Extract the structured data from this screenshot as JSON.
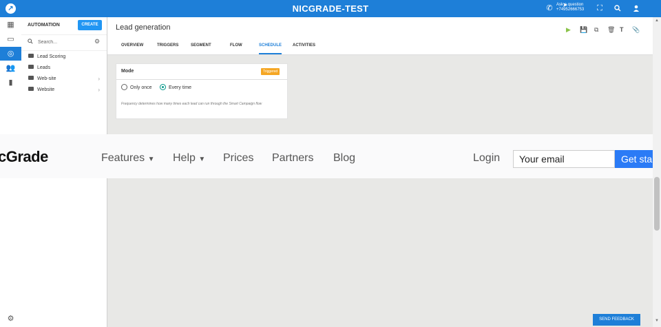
{
  "topbar": {
    "title": "NICGRADE-TEST",
    "logo_icon": "nicgrade-logo-icon",
    "ask_question": "Ask a question",
    "phone_number": "+74952666753",
    "icons": [
      "phone-icon",
      "fullscreen-icon",
      "search-icon",
      "user-icon"
    ]
  },
  "leftnav": {
    "icons": [
      "dashboard-icon",
      "monitor-icon",
      "automation-icon",
      "contacts-icon",
      "analytics-icon"
    ],
    "active": "automation-icon",
    "bottom_icon": "settings-gear-icon"
  },
  "panel": {
    "title": "AUTOMATION",
    "create_label": "CREATE",
    "search_placeholder": "Search...",
    "folders": [
      {
        "label": "Lead Scoring",
        "expandable": false
      },
      {
        "label": "Leads",
        "expandable": false
      },
      {
        "label": "Web-site",
        "expandable": true
      },
      {
        "label": "Website",
        "expandable": true
      }
    ]
  },
  "main": {
    "title": "Lead generation",
    "tabs": [
      {
        "label": "OVERVIEW",
        "active": false
      },
      {
        "label": "TRIGGERS",
        "active": false
      },
      {
        "label": "SEGMENT",
        "active": false
      },
      {
        "label": "FLOW",
        "active": false
      },
      {
        "label": "SCHEDULE",
        "active": true
      },
      {
        "label": "ACTIVITIES",
        "active": false
      }
    ],
    "toolbar_icons": [
      "play-icon",
      "save-icon",
      "copy-icon",
      "delete-icon",
      "text-icon",
      "attach-icon"
    ]
  },
  "schedule_card": {
    "mode_label": "Mode",
    "badge": "Triggered",
    "options": [
      {
        "label": "Only once",
        "selected": false
      },
      {
        "label": "Every time",
        "selected": true
      }
    ],
    "help_text": "Frequency determines how many times each lead can run through the Smart Campaign flow"
  },
  "overlay": {
    "brand": "cGrade",
    "nav": [
      {
        "label": "Features",
        "dropdown": true
      },
      {
        "label": "Help",
        "dropdown": true
      },
      {
        "label": "Prices",
        "dropdown": false
      },
      {
        "label": "Partners",
        "dropdown": false
      },
      {
        "label": "Blog",
        "dropdown": false
      }
    ],
    "login": "Login",
    "email_placeholder": "Your email",
    "cta": "Get started"
  },
  "feedback_label": "SEND FEEDBACK",
  "colors": {
    "primary": "#1e7fd8",
    "badge": "#f5a623",
    "radio": "#009688",
    "cta": "#2b7bf6"
  }
}
